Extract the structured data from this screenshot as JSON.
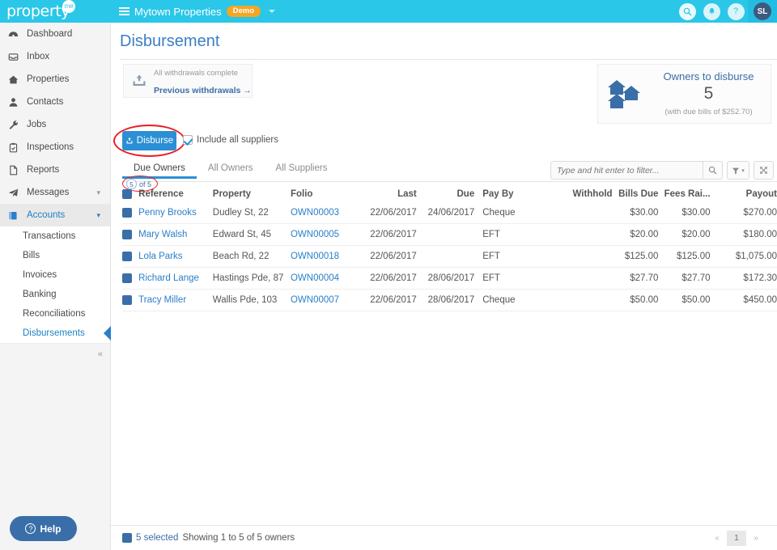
{
  "topbar": {
    "logo": "property",
    "logo_badge": "me",
    "list_icon": "list-icon",
    "org_name": "Mytown Properties",
    "demo_badge": "Demo",
    "caret_icon": "chevron-down-icon",
    "icons": [
      {
        "name": "search-icon",
        "glyph": "search"
      },
      {
        "name": "notification-bell-icon",
        "glyph": "bell"
      },
      {
        "name": "help-icon",
        "glyph": "?"
      }
    ],
    "avatar_initials": "SL"
  },
  "sidebar": {
    "items": [
      {
        "label": "Dashboard",
        "icon": "dashboard-icon",
        "chevron": false
      },
      {
        "label": "Inbox",
        "icon": "inbox-icon",
        "chevron": false
      },
      {
        "label": "Properties",
        "icon": "home-icon",
        "chevron": false
      },
      {
        "label": "Contacts",
        "icon": "person-icon",
        "chevron": false
      },
      {
        "label": "Jobs",
        "icon": "wrench-icon",
        "chevron": false
      },
      {
        "label": "Inspections",
        "icon": "clipboard-check-icon",
        "chevron": false
      },
      {
        "label": "Reports",
        "icon": "document-icon",
        "chevron": false
      },
      {
        "label": "Messages",
        "icon": "paper-plane-icon",
        "chevron": true
      },
      {
        "label": "Accounts",
        "icon": "book-icon",
        "chevron": true,
        "active": true
      }
    ],
    "subitems": [
      {
        "label": "Transactions"
      },
      {
        "label": "Bills"
      },
      {
        "label": "Invoices"
      },
      {
        "label": "Banking"
      },
      {
        "label": "Reconciliations"
      },
      {
        "label": "Disbursements",
        "current": true
      }
    ],
    "collapse_icon": "collapse-sidebar-icon",
    "help_label": "Help",
    "help_icon": "question-circle-icon"
  },
  "page": {
    "title": "Disbursement"
  },
  "withdrawals": {
    "icon": "upload-icon",
    "status": "All withdrawals complete",
    "link": "Previous withdrawals  →"
  },
  "owners_card": {
    "icon": "houses-icon",
    "title": "Owners to disburse",
    "count": "5",
    "subtitle": "(with due bills of $252.70)"
  },
  "toolbar": {
    "disburse_label": "Disburse",
    "disburse_icon": "upload-icon",
    "include_suppliers_label": "Include all suppliers",
    "include_suppliers_checked": true,
    "annotation_color": "#ee1c24"
  },
  "search": {
    "placeholder": "Type and hit enter to filter...",
    "value": "",
    "search_icon": "search-icon",
    "filter_icon": "funnel-icon",
    "expand_icon": "fullscreen-icon"
  },
  "tabs": [
    {
      "label": "Due Owners",
      "active": true
    },
    {
      "label": "All Owners",
      "active": false
    },
    {
      "label": "All Suppliers",
      "active": false
    }
  ],
  "count_badge": {
    "selected": "5",
    "of_text": "of 5"
  },
  "table": {
    "select_all_checked": true,
    "columns": [
      "Reference",
      "Property",
      "Folio",
      "Last",
      "Due",
      "Pay By",
      "Withhold",
      "Bills Due",
      "Fees Rai...",
      "Payout"
    ],
    "rows": [
      {
        "checked": true,
        "reference": "Penny Brooks",
        "property": "Dudley St, 22",
        "folio": "OWN00003",
        "last": "22/06/2017",
        "due": "24/06/2017",
        "pay_by": "Cheque",
        "withhold": "",
        "bills_due": "$30.00",
        "fees_raised": "$30.00",
        "payout": "$270.00"
      },
      {
        "checked": true,
        "reference": "Mary Walsh",
        "property": "Edward St, 45",
        "folio": "OWN00005",
        "last": "22/06/2017",
        "due": "",
        "pay_by": "EFT",
        "withhold": "",
        "bills_due": "$20.00",
        "fees_raised": "$20.00",
        "payout": "$180.00"
      },
      {
        "checked": true,
        "reference": "Lola Parks",
        "property": "Beach Rd, 22",
        "folio": "OWN00018",
        "last": "22/06/2017",
        "due": "",
        "pay_by": "EFT",
        "withhold": "",
        "bills_due": "$125.00",
        "fees_raised": "$125.00",
        "payout": "$1,075.00"
      },
      {
        "checked": true,
        "reference": "Richard Lange",
        "property": "Hastings Pde, 87",
        "folio": "OWN00004",
        "last": "22/06/2017",
        "due": "28/06/2017",
        "pay_by": "EFT",
        "withhold": "",
        "bills_due": "$27.70",
        "fees_raised": "$27.70",
        "payout": "$172.30"
      },
      {
        "checked": true,
        "reference": "Tracy Miller",
        "property": "Wallis Pde, 103",
        "folio": "OWN00007",
        "last": "22/06/2017",
        "due": "28/06/2017",
        "pay_by": "Cheque",
        "withhold": "",
        "bills_due": "$50.00",
        "fees_raised": "$50.00",
        "payout": "$450.00"
      }
    ]
  },
  "footer": {
    "select_all_checked": true,
    "selected_text": "5 selected",
    "showing_text": "Showing 1 to 5 of 5 owners",
    "pagination": {
      "first_icon": "«",
      "current_page": "1",
      "last_icon": "»"
    }
  }
}
